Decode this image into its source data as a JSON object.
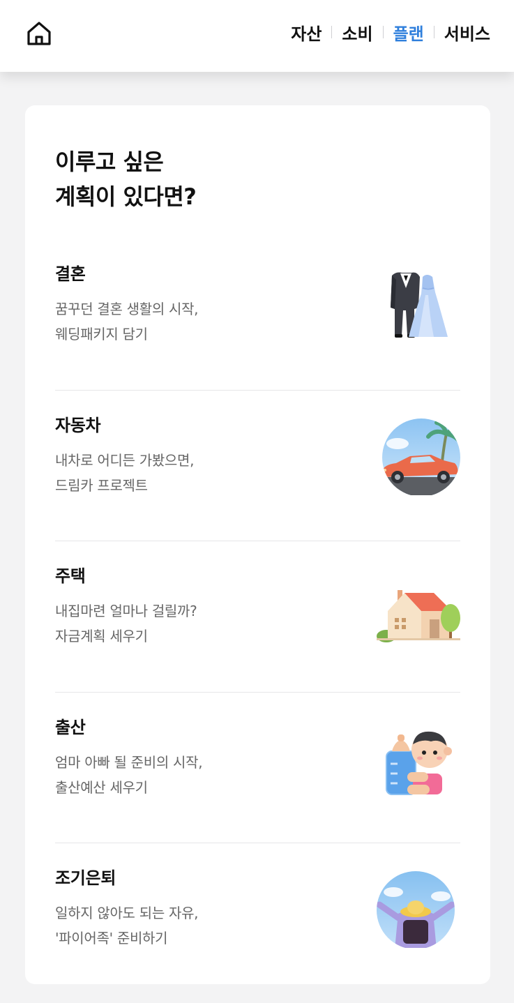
{
  "header": {
    "home_icon": "home-icon",
    "nav": [
      {
        "label": "자산",
        "active": false
      },
      {
        "label": "소비",
        "active": false
      },
      {
        "label": "플랜",
        "active": true
      },
      {
        "label": "서비스",
        "active": false
      }
    ],
    "accent_color": "#2f7fdc"
  },
  "main": {
    "headline_line1": "이루고 싶은",
    "headline_line2": "계획이 있다면?",
    "plans": [
      {
        "title": "결혼",
        "desc": "꿈꾸던 결혼 생활의 시작,\n웨딩패키지 담기",
        "icon": "wedding-icon"
      },
      {
        "title": "자동차",
        "desc": "내차로 어디든 가봤으면,\n드림카 프로젝트",
        "icon": "car-icon"
      },
      {
        "title": "주택",
        "desc": "내집마련 얼마나 걸릴까?\n자금계획 세우기",
        "icon": "house-icon"
      },
      {
        "title": "출산",
        "desc": "엄마 아빠 될 준비의 시작,\n출산예산 세우기",
        "icon": "baby-icon"
      },
      {
        "title": "조기은퇴",
        "desc": "일하지 않아도 되는 자유,\n'파이어족' 준비하기",
        "icon": "retirement-icon"
      }
    ]
  }
}
